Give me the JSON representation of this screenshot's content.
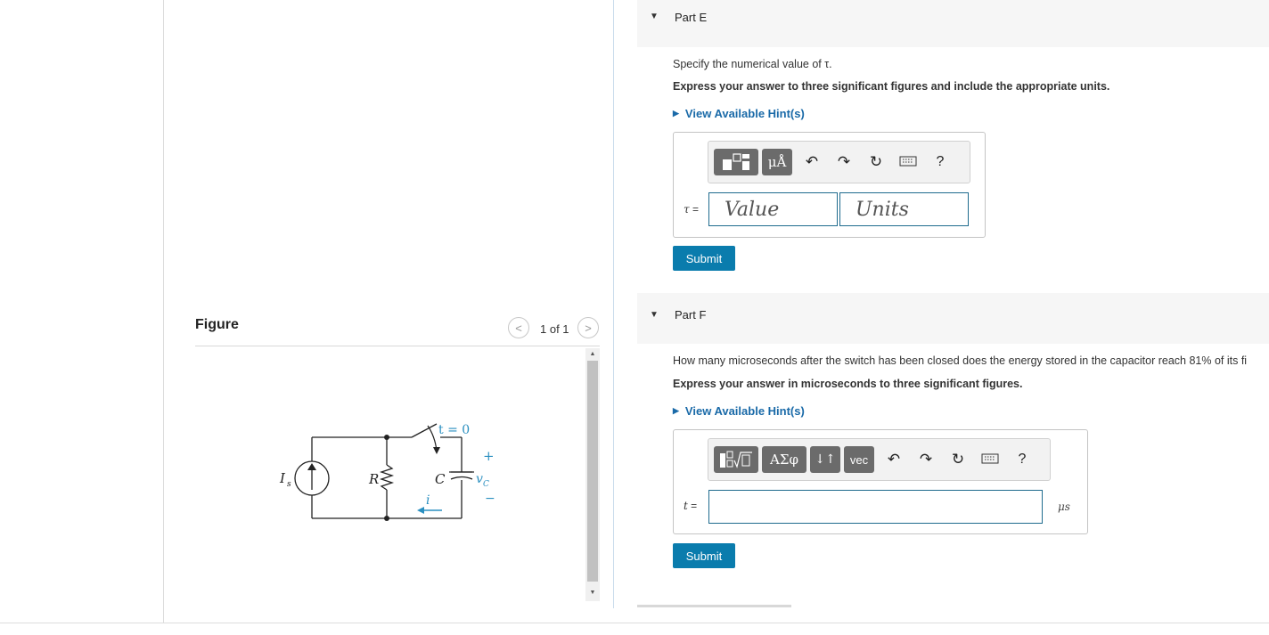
{
  "figure": {
    "title": "Figure",
    "pager": "1 of 1",
    "circuit": {
      "source_label": "I",
      "source_sub": "s",
      "resistor_label": "R",
      "capacitor_label": "C",
      "switch_label": "t = 0",
      "voltage_label": "v",
      "voltage_sub": "C",
      "plus": "+",
      "minus": "−",
      "current_label": "i"
    }
  },
  "partE": {
    "title": "Part E",
    "question": "Specify the numerical value of τ.",
    "instruction": "Express your answer to three significant figures and include the appropriate units.",
    "hint": "View Available Hint(s)",
    "toolbar": {
      "units_btn": "μÅ",
      "help": "?"
    },
    "var": "τ",
    "eq": "=",
    "value_placeholder": "Value",
    "units_placeholder": "Units",
    "submit": "Submit"
  },
  "partF": {
    "title": "Part F",
    "question": "How many microseconds after the switch has been closed does the energy stored in the capacitor reach 81% of its fi",
    "instruction": "Express your answer in microseconds to three significant figures.",
    "hint": "View Available Hint(s)",
    "toolbar": {
      "greek_btn": "ΑΣφ",
      "updown_btn": "↓↑",
      "vec_btn": "vec",
      "help": "?"
    },
    "var": "t",
    "eq": "=",
    "answer_value": "",
    "unit": "μs",
    "submit": "Submit"
  }
}
